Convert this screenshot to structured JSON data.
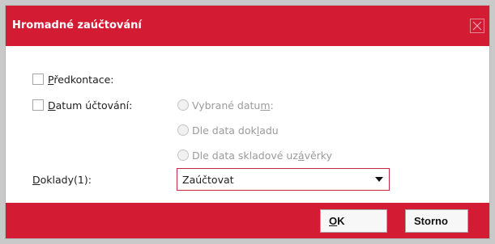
{
  "dialog": {
    "title": "Hromadné zaúčtování",
    "close_icon": "close-icon"
  },
  "options": {
    "predkontace": {
      "hotkey": "P",
      "rest": "ředkontace:",
      "checked": false
    },
    "datum_uctovani": {
      "hotkey": "D",
      "rest": "atum účtování:",
      "checked": false
    }
  },
  "radios": [
    {
      "pre": "Vybrané datu",
      "hotkey": "m",
      "post": ":",
      "enabled": false
    },
    {
      "pre": "Dle data dok",
      "hotkey": "l",
      "post": "adu",
      "enabled": false
    },
    {
      "pre": "Dle data skladové uz",
      "hotkey": "á",
      "post": "věrky",
      "enabled": false
    }
  ],
  "doklady": {
    "hotkey": "D",
    "rest": "oklady(1):",
    "selected_value": "Zaúčtovat"
  },
  "buttons": {
    "ok": {
      "hotkey": "O",
      "rest": "K"
    },
    "storno": "Storno"
  },
  "colors": {
    "accent": "#d31b34",
    "select_border": "#c12a3f"
  }
}
